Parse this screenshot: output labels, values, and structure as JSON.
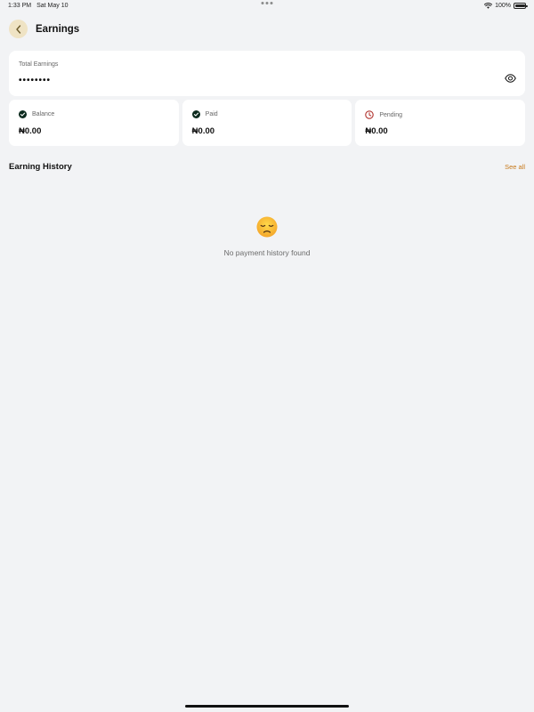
{
  "status_bar": {
    "time": "1:33 PM",
    "date": "Sat May 10",
    "battery": "100%"
  },
  "header": {
    "title": "Earnings"
  },
  "total": {
    "label": "Total Earnings",
    "value": "••••••••"
  },
  "stats": [
    {
      "label": "Balance",
      "value": "₦0.00",
      "icon": "check-circle-icon"
    },
    {
      "label": "Paid",
      "value": "₦0.00",
      "icon": "check-circle-icon"
    },
    {
      "label": "Pending",
      "value": "₦0.00",
      "icon": "clock-icon"
    }
  ],
  "history": {
    "title": "Earning History",
    "see_all": "See all",
    "empty_emoji": "disappointed-face",
    "empty_text": "No payment history found"
  },
  "colors": {
    "background": "#f2f3f5",
    "accent": "#c7791a",
    "back_button_bg": "#efe3c4",
    "pending_icon": "#b0322d"
  }
}
